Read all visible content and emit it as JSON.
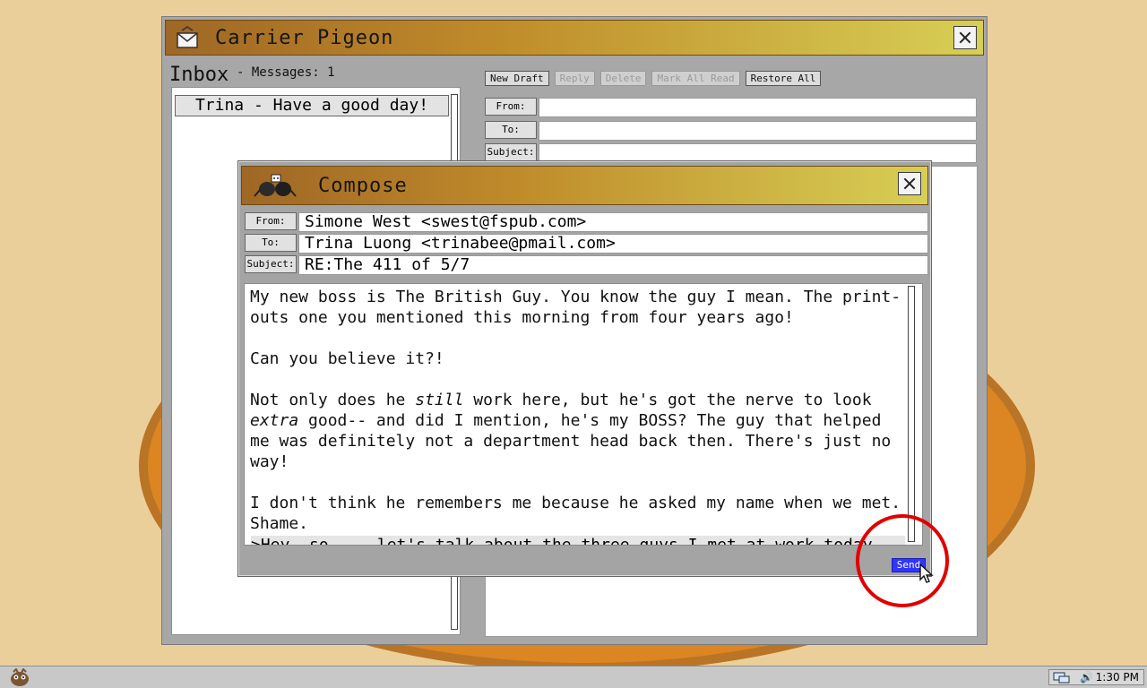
{
  "main_window": {
    "title": "Carrier Pigeon",
    "inbox_title": "Inbox",
    "messages_count": "- Messages: 1",
    "inbox_items": [
      {
        "label": "Trina - Have a good day!"
      }
    ],
    "toolbar": {
      "new_draft": "New Draft",
      "reply": "Reply",
      "delete": "Delete",
      "mark_all_read": "Mark All Read",
      "restore_all": "Restore All"
    },
    "fields": {
      "from": "From:",
      "to": "To:",
      "subject": "Subject:"
    }
  },
  "compose": {
    "title": "Compose",
    "fields": {
      "from_label": "From:",
      "to_label": "To:",
      "subject_label": "Subject:",
      "from_value": "Simone West <swest@fspub.com>",
      "to_value": "Trina Luong <trinabee@pmail.com>",
      "subject_value": "RE:The 411 of 5/7"
    },
    "body": {
      "line1": "My new boss is The British Guy. You know the guy I mean. The print-",
      "line2": "outs one you mentioned this morning from four years ago!",
      "line3": "Can you believe it?!",
      "line4a": "Not only does he ",
      "line4b": "still",
      "line4c": " work here, but he's got the nerve to look",
      "line5a": "extra",
      "line5b": " good-- and did I mention, he's my BOSS? The guy that helped",
      "line6": "me was definitely not a department head back then. There's just no",
      "line7": "way!",
      "line8": "I don't think he remembers me because he asked my name when we met.",
      "line9": "Shame.",
      "quote": ">Hey, so.... let's talk about the three guys I met at work today."
    },
    "send_label": "Send"
  },
  "taskbar": {
    "time": "1:30 PM",
    "speaker": "🔊"
  },
  "colors": {
    "title_gradient_start": "#9f6725",
    "title_gradient_end": "#d7cf55",
    "send_button": "#3035ff",
    "highlight": "#e10000"
  }
}
